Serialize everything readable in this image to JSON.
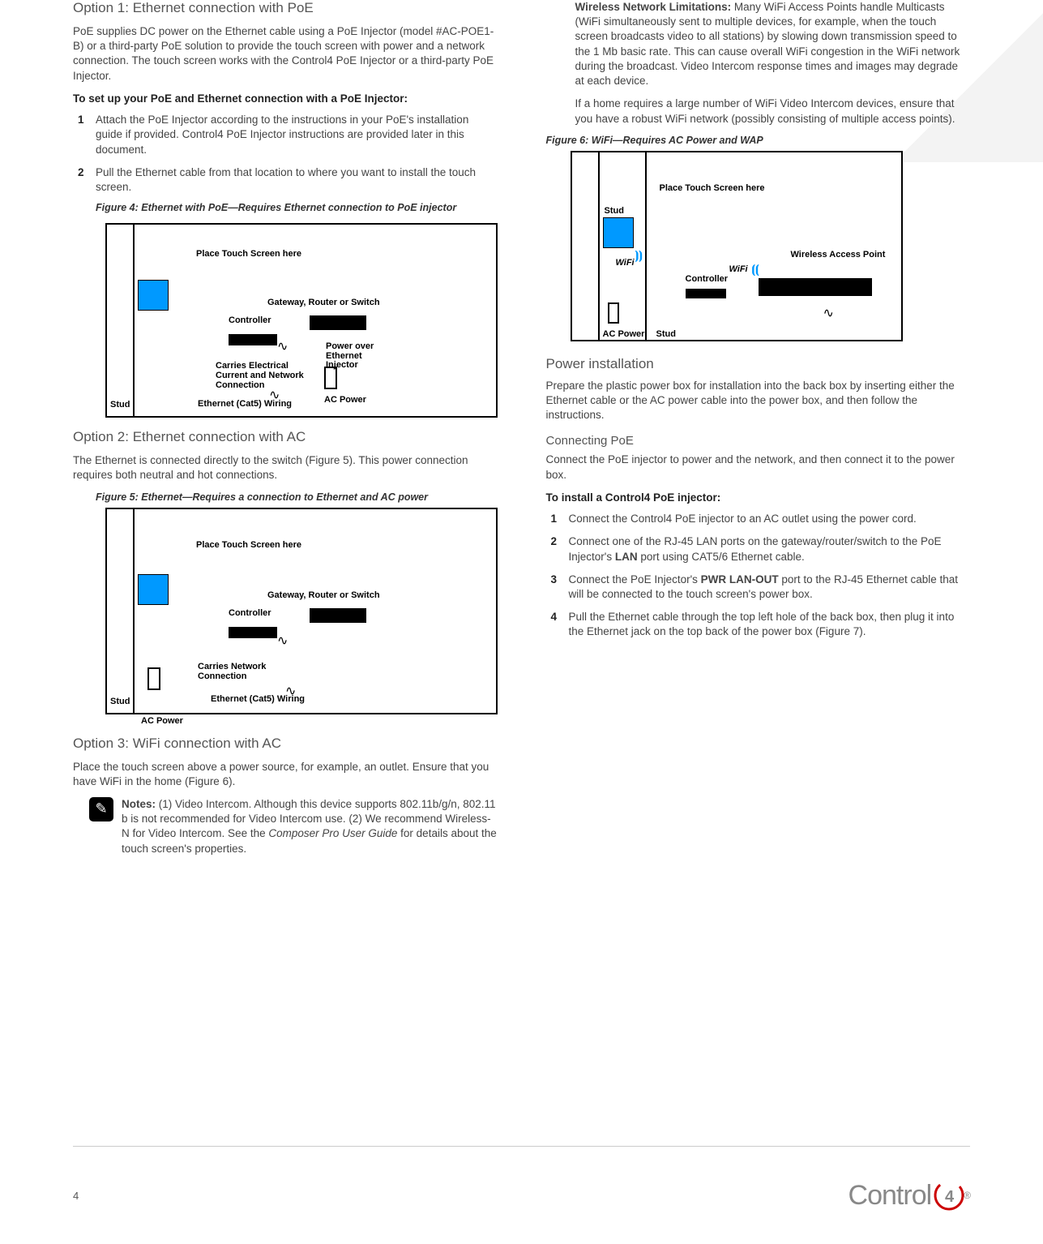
{
  "left": {
    "opt1_title": "Option 1: Ethernet connection with PoE",
    "opt1_p1": "PoE supplies DC power on the Ethernet cable using a PoE Injector (model #AC-POE1-B) or a third-party PoE solution to provide the touch screen with power and a network connection. The touch screen works with the Control4 PoE Injector or a third-party PoE Injector.",
    "opt1_setup": "To set up your PoE and Ethernet connection with a PoE Injector:",
    "opt1_step1": "Attach the PoE Injector according to the instructions in your PoE's installation guide if provided. Control4 PoE Injector instructions are provided later in this document.",
    "opt1_step2": "Pull the Ethernet cable from that location to where you want to install the touch screen.",
    "fig4_caption": "Figure 4: Ethernet with PoE—Requires Ethernet connection to PoE injector",
    "fig4": {
      "place": "Place  Touch Screen here",
      "gateway": "Gateway, Router or Switch",
      "controller": "Controller",
      "poe": "Power over Ethernet Injector",
      "carries": "Carries Electrical Current and Network Connection",
      "stud": "Stud",
      "wiring": "Ethernet (Cat5) Wiring",
      "ac": "AC Power"
    },
    "opt2_title": "Option 2: Ethernet connection with AC",
    "opt2_p1": "The Ethernet is connected directly to the switch (Figure 5). This power connection requires both neutral and hot connections.",
    "fig5_caption": "Figure 5: Ethernet—Requires a connection to Ethernet and AC power",
    "fig5": {
      "place": "Place  Touch Screen here",
      "gateway": "Gateway, Router or Switch",
      "controller": "Controller",
      "carries": "Carries Network Connection",
      "stud": "Stud",
      "wiring": "Ethernet (Cat5) Wiring",
      "ac": "AC Power"
    },
    "opt3_title": "Option 3: WiFi connection with AC",
    "opt3_p1": "Place the touch screen above a power source, for example, an outlet. Ensure that you have WiFi in the home (Figure 6).",
    "notes_label": "Notes:",
    "notes_body": " (1) Video Intercom. Although this device supports 802.11b/g/n, 802.11 b is not recommended for Video Intercom use. (2) We recommend Wireless-N for Video Intercom. See the ",
    "notes_guide": "Composer Pro User Guide",
    "notes_tail": " for details about the touch screen's properties."
  },
  "right": {
    "wnl_label": "Wireless Network Limitations:",
    "wnl_body": " Many WiFi Access Points handle Multicasts (WiFi simultaneously sent to multiple devices, for example, when the touch screen broadcasts video to all stations) by slowing down transmission speed to the 1 Mb basic rate. This can cause overall WiFi congestion in the WiFi network during the broadcast. Video Intercom response times and images may degrade at each device.",
    "wnl_p2": "If a home requires a large number of WiFi Video Intercom devices, ensure that you have a robust WiFi network (possibly consisting of multiple access points).",
    "fig6_caption": "Figure 6: WiFi—Requires AC Power and WAP",
    "fig6": {
      "place": "Place Touch Screen here",
      "stud": "Stud",
      "wifi": "WiFi",
      "wap": "Wireless Access Point",
      "controller": "Controller",
      "ac": "AC Power",
      "stud2": "Stud"
    },
    "power_title": "Power installation",
    "power_p1": "Prepare the plastic power box for installation into the back box by inserting either the Ethernet cable or the AC power cable into the power box, and then follow the instructions.",
    "cpoe_title": "Connecting PoE",
    "cpoe_p1": "Connect the PoE injector to power and the network, and then connect it to the power box.",
    "install_heading": "To install a Control4 PoE injector:",
    "step1": "Connect the Control4 PoE injector to an AC outlet using the power cord.",
    "step2a": "Connect one of the RJ-45 LAN ports on the gateway/router/switch to the PoE Injector's ",
    "step2_lan": "LAN",
    "step2b": " port using CAT5/6 Ethernet cable.",
    "step3a": "Connect the PoE Injector's ",
    "step3_pwr": "PWR LAN-OUT",
    "step3b": " port to the RJ-45 Ethernet cable that will be connected to the touch screen's power box.",
    "step4": "Pull the Ethernet cable through the top left hole of the back box, then plug it into the Ethernet jack on the top back of the power box (Figure 7)."
  },
  "footer": {
    "page": "4",
    "brand": "Control"
  }
}
